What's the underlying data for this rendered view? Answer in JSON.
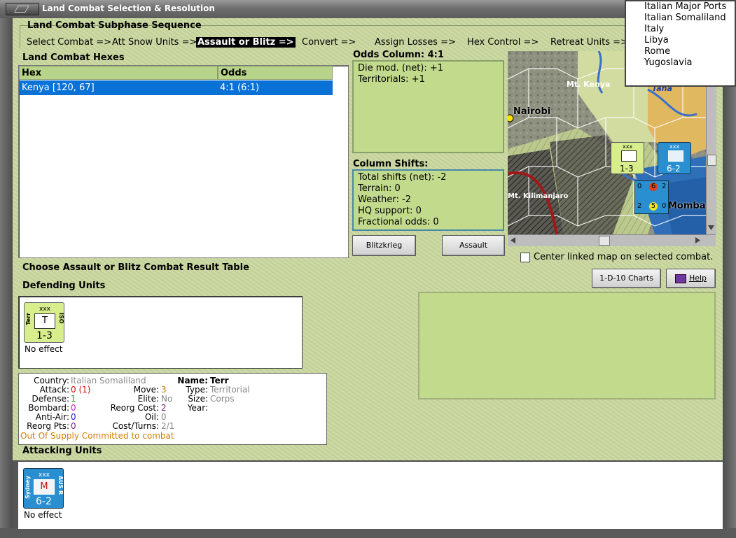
{
  "window": {
    "title": "Land Combat Selection & Resolution"
  },
  "sequence": {
    "heading": "Land Combat Subphase Sequence",
    "steps": [
      "Select Combat =>",
      "Att Snow Units =>",
      "Assault or Blitz =>",
      "Convert =>",
      "Assign Losses =>",
      "Hex Control =>",
      "Retreat Units =>"
    ],
    "active_index": 2
  },
  "hexes": {
    "heading": "Land Combat Hexes",
    "columns": [
      "Hex",
      "Odds"
    ],
    "rows": [
      {
        "hex": "Kenya [120, 67]",
        "odds": "4:1 (6:1)"
      }
    ]
  },
  "odds": {
    "heading": "Odds Column: 4:1",
    "lines": [
      "Die mod. (net): +1",
      "Territorials: +1"
    ]
  },
  "shifts": {
    "heading": "Column Shifts:",
    "lines": [
      "Total shifts (net): -2",
      "Terrain: 0",
      "Weather: -2",
      "HQ support: 0",
      "Fractional odds: 0"
    ]
  },
  "buttons": {
    "blitzkrieg": "Blitzkrieg",
    "assault": "Assault",
    "charts": "1-D-10 Charts",
    "help": "Help"
  },
  "map": {
    "labels": {
      "kenya": "Mt. Kenya",
      "nairobi": "Nairobi",
      "kilimanjaro": "Mt. Kilimanjaro",
      "mombasa": "Momba",
      "tana": "Tana"
    },
    "center_label": "Center linked map on selected combat.",
    "center_checked": false
  },
  "crt_prompt": "Choose Assault or Blitz Combat Result Table",
  "defending": {
    "heading": "Defending Units",
    "unit": {
      "size": "xxx",
      "name_side": "Terr",
      "side_right": "ISO",
      "symbol": "T",
      "strength": "1-3",
      "result": "No effect"
    }
  },
  "info": {
    "country_label": "Country:",
    "country": "Italian Somaliland",
    "attack_label": "Attack:",
    "attack": "0",
    "attack_extra": "(1)",
    "defense_label": "Defense:",
    "defense": "1",
    "bombard_label": "Bombard:",
    "bombard": "0",
    "antiair_label": "Anti-Air:",
    "antiair": "0",
    "reorg_label": "Reorg Pts:",
    "reorg": "0",
    "move_label": "Move:",
    "move": "3",
    "elite_label": "Elite:",
    "elite": "No",
    "reorgcost_label": "Reorg Cost:",
    "reorgcost": "2",
    "oil_label": "Oil:",
    "oil": "0",
    "costturns_label": "Cost/Turns:",
    "costturns": "2/1",
    "name_label": "Name:",
    "name": "Terr",
    "type_label": "Type:",
    "type": "Territorial",
    "size_label": "Size:",
    "size": "Corps",
    "year_label": "Year:",
    "year": "",
    "supply": "Out Of Supply",
    "committed": "Committed to combat"
  },
  "attacking": {
    "heading": "Attacking Units",
    "unit": {
      "size": "xxx",
      "name_side": "Sydney",
      "side_right": "AUS R",
      "symbol": "M",
      "strength": "6-2",
      "result": "No effect"
    }
  },
  "map_units": {
    "terr": {
      "size": "xxx",
      "strength": "1-3"
    },
    "sydney": {
      "size": "xxx",
      "strength": "6-2"
    },
    "stack": {
      "top": "6",
      "bottom": "5",
      "l1": "0",
      "r1": "2",
      "l2": "2",
      "r2": "0"
    }
  },
  "popup_menu": [
    "Italian Major Ports",
    "Italian Somaliland",
    "Italy",
    "Libya",
    "Rome",
    "Yugoslavia"
  ],
  "colors": {
    "panel": "#cad8a0",
    "selection": "#0a72d6",
    "terr_counter": "#d8ee8c",
    "aus_counter": "#2a8fd0"
  }
}
